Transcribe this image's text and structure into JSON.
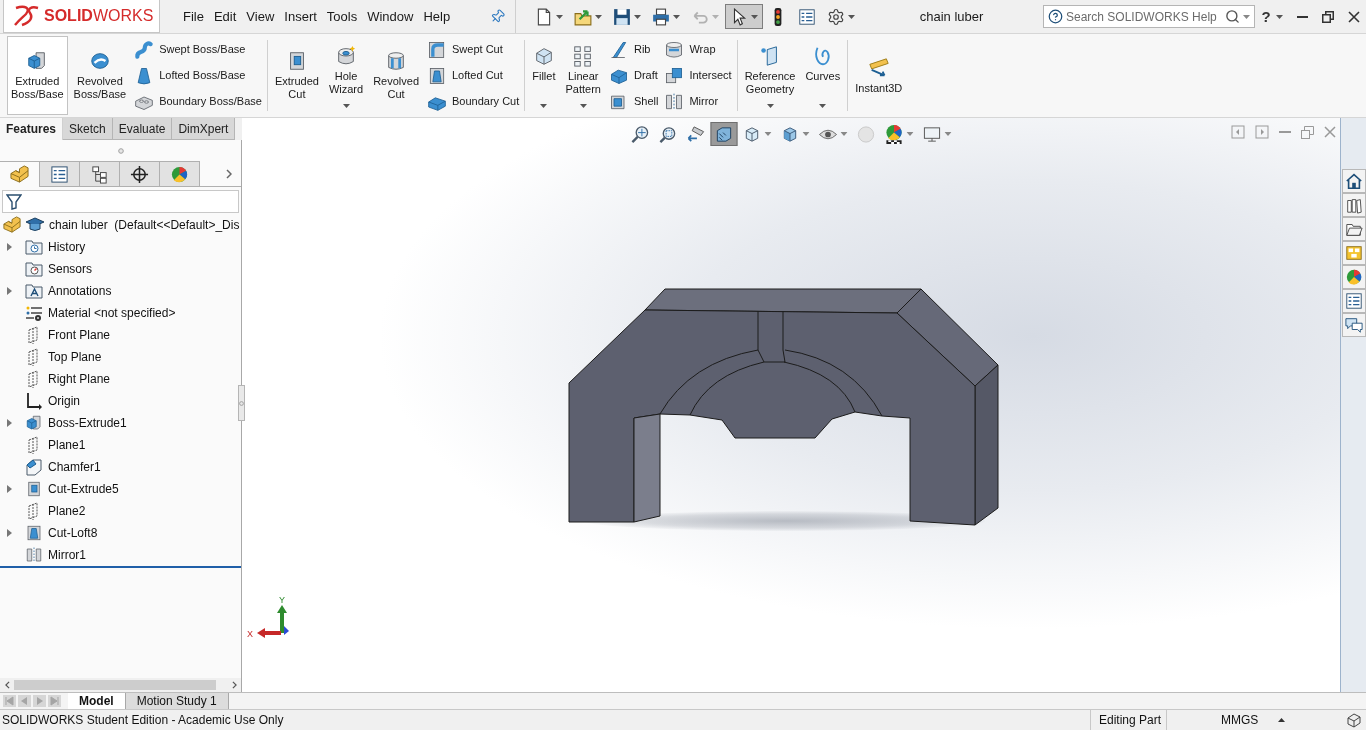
{
  "app_bar": {
    "logo": "**SOLID**WORKS",
    "menu": [
      "File",
      "Edit",
      "View",
      "Insert",
      "Tools",
      "Window",
      "Help"
    ],
    "quick_access": [
      {
        "dropdown": true,
        "pressed": false,
        "disabled": false
      },
      {
        "dropdown": true,
        "pressed": false,
        "disabled": false
      },
      {
        "dropdown": true,
        "pressed": false,
        "disabled": false
      },
      {
        "dropdown": true,
        "pressed": false,
        "disabled": false
      },
      {
        "dropdown": true,
        "pressed": false,
        "disabled": true
      },
      {
        "dropdown": true,
        "pressed": true,
        "disabled": false
      },
      {
        "dropdown": false,
        "pressed": false,
        "disabled": false
      },
      {
        "dropdown": false,
        "pressed": false,
        "disabled": false
      },
      {
        "dropdown": true,
        "pressed": false,
        "disabled": false
      }
    ],
    "document_title": "chain luber",
    "search": {
      "placeholder": "Search SOLIDWORKS Help"
    },
    "help": "?"
  },
  "ribbon": {
    "groups": [
      {
        "items": [
          {
            "kind": "large",
            "label": "Extruded Boss/Base",
            "highlighted": true,
            "dropdown": false
          },
          {
            "kind": "large",
            "label": "Revolved Boss/Base",
            "highlighted": false,
            "dropdown": false
          },
          {
            "kind": "column",
            "items": [
              {
                "label": "Swept Boss/Base"
              },
              {
                "label": "Lofted Boss/Base"
              },
              {
                "label": "Boundary Boss/Base"
              }
            ]
          }
        ]
      },
      {
        "items": [
          {
            "kind": "large",
            "label": "Extruded Cut",
            "highlighted": false,
            "dropdown": false
          },
          {
            "kind": "large",
            "label": "Hole Wizard",
            "highlighted": false,
            "dropdown": true
          },
          {
            "kind": "large",
            "label": "Revolved Cut",
            "highlighted": false,
            "dropdown": false
          },
          {
            "kind": "column",
            "items": [
              {
                "label": "Swept Cut"
              },
              {
                "label": "Lofted Cut"
              },
              {
                "label": "Boundary Cut"
              }
            ]
          }
        ]
      },
      {
        "items": [
          {
            "kind": "large",
            "label": "Fillet",
            "highlighted": false,
            "dropdown": true
          },
          {
            "kind": "large",
            "label": "Linear Pattern",
            "highlighted": false,
            "dropdown": true
          },
          {
            "kind": "column",
            "items": [
              {
                "label": "Rib"
              },
              {
                "label": "Draft"
              },
              {
                "label": "Shell"
              }
            ]
          },
          {
            "kind": "column",
            "items": [
              {
                "label": "Wrap"
              },
              {
                "label": "Intersect"
              },
              {
                "label": "Mirror"
              }
            ]
          }
        ]
      },
      {
        "items": [
          {
            "kind": "large",
            "label": "Reference Geometry",
            "highlighted": false,
            "dropdown": true
          },
          {
            "kind": "large",
            "label": "Curves",
            "highlighted": false,
            "dropdown": true
          }
        ]
      },
      {
        "items": [
          {
            "kind": "large",
            "label": "Instant3D",
            "highlighted": false,
            "dropdown": false
          }
        ]
      }
    ]
  },
  "command_tabs": [
    {
      "label": "Features",
      "selected": true
    },
    {
      "label": "Sketch",
      "selected": false
    },
    {
      "label": "Evaluate",
      "selected": false
    },
    {
      "label": "DimXpert",
      "selected": false
    }
  ],
  "feature_manager": {
    "tabs": [
      {
        "selected": true
      },
      {
        "selected": false
      },
      {
        "selected": false
      },
      {
        "selected": false
      },
      {
        "selected": false
      }
    ],
    "tree": {
      "label": "chain luber  (Default<<Default>_Dis",
      "children": [
        {
          "label": "History",
          "kind": "history",
          "expandable": true
        },
        {
          "label": "Sensors",
          "kind": "sensors",
          "expandable": false
        },
        {
          "label": "Annotations",
          "kind": "annotations",
          "expandable": true
        },
        {
          "label": "Material <not specified>",
          "kind": "material",
          "expandable": false
        },
        {
          "label": "Front Plane",
          "kind": "plane",
          "expandable": false
        },
        {
          "label": "Top Plane",
          "kind": "plane",
          "expandable": false
        },
        {
          "label": "Right Plane",
          "kind": "plane",
          "expandable": false
        },
        {
          "label": "Origin",
          "kind": "origin",
          "expandable": false
        },
        {
          "label": "Boss-Extrude1",
          "kind": "boss",
          "expandable": true
        },
        {
          "label": "Plane1",
          "kind": "plane",
          "expandable": false
        },
        {
          "label": "Chamfer1",
          "kind": "chamfer",
          "expandable": false
        },
        {
          "label": "Cut-Extrude5",
          "kind": "cut",
          "expandable": true
        },
        {
          "label": "Plane2",
          "kind": "plane",
          "expandable": false
        },
        {
          "label": "Cut-Loft8",
          "kind": "loftcut",
          "expandable": true
        },
        {
          "label": "Mirror1",
          "kind": "mirror",
          "expandable": false
        }
      ]
    }
  },
  "graphics": {
    "view_toolbar": [
      {
        "dropdown": false,
        "pressed": false
      },
      {
        "dropdown": false,
        "pressed": false
      },
      {
        "dropdown": false,
        "pressed": false
      },
      {
        "dropdown": false,
        "pressed": true
      },
      {
        "dropdown": true,
        "pressed": false
      },
      {
        "dropdown": true,
        "pressed": false
      },
      {
        "dropdown": true,
        "pressed": false
      },
      {
        "dropdown": false,
        "pressed": false
      },
      {
        "dropdown": true,
        "pressed": false
      },
      {
        "dropdown": true,
        "pressed": false
      }
    ],
    "triad": {
      "x_label": "X",
      "y_label": "Y"
    }
  },
  "bottom_tabs": [
    {
      "label": "Model",
      "selected": true
    },
    {
      "label": "Motion Study 1",
      "selected": false
    }
  ],
  "status_bar": {
    "message": "SOLIDWORKS Student Edition - Academic Use Only",
    "mode": "Editing Part",
    "units": "MMGS"
  }
}
